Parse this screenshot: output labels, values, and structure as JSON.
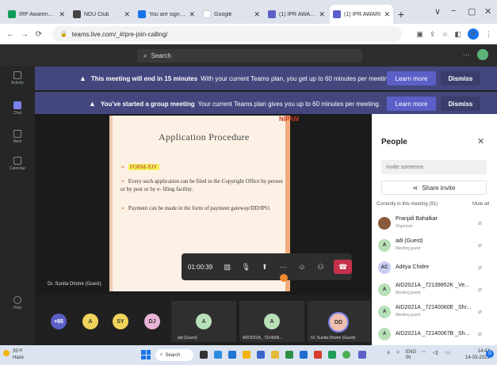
{
  "browser": {
    "tabs": [
      {
        "title": "IRP Awareness - G",
        "fav_color": "#0f9d58",
        "active": false
      },
      {
        "title": "NDU Club",
        "fav_color": "#444444",
        "active": false
      },
      {
        "title": "You are signed in",
        "fav_color": "#1a73e8",
        "active": false
      },
      {
        "title": "Google",
        "fav_color": "#ffffff",
        "active": false
      },
      {
        "title": "(1) IPR AWARENES",
        "fav_color": "#5b5fc7",
        "active": false
      },
      {
        "title": "(1) IPR AWARI",
        "fav_color": "#5b5fc7",
        "active": true
      }
    ],
    "new_tab": "+",
    "window_controls": [
      "∨",
      "−",
      "▢",
      "✕"
    ],
    "url": "teams.live.com/_#/pre-join-calling/",
    "profile_initial": "P"
  },
  "teams": {
    "search_placeholder": "Search",
    "more": "···"
  },
  "rail": [
    {
      "label": "Activity",
      "active": false
    },
    {
      "label": "Chat",
      "active": true
    },
    {
      "label": "Meet",
      "active": false
    },
    {
      "label": "Calendar",
      "active": false
    },
    {
      "label": "Help",
      "active": false
    }
  ],
  "banners": [
    {
      "bold": "This meeting will end in 15 minutes",
      "text": "With your current Teams plan, you get up to 60 minutes per meeting.",
      "learn": "Learn more",
      "dismiss": "Dismiss"
    },
    {
      "bold": "You've started a group meeting",
      "text": "Your current Teams plan gives you up to 60 minutes per meeting.",
      "learn": "Learn more",
      "dismiss": "Dismiss"
    }
  ],
  "slide": {
    "header": "NIPAM",
    "title": "Application Procedure",
    "form": "FORM-XIV",
    "bullet1": "Every such application can be filed in the Copyright Office by person or by post or by e- filing facility.",
    "bullet2": "Payment can be made in the form of payment gateway/DD/IPO."
  },
  "speaker": "Dr. Sunita Dhotre (Guest)",
  "controls": {
    "timer": "01:00:39",
    "icons": [
      "camera-off-icon",
      "mic-off-icon",
      "share-icon",
      "more-icon",
      "reactions-icon",
      "people-icon"
    ],
    "leave": "leave-call-icon"
  },
  "strip": {
    "overflow": "+85",
    "bubbles": [
      {
        "initials": "A",
        "color": "#f0d35c"
      },
      {
        "initials": "SY",
        "color": "#f0d35c"
      },
      {
        "initials": "DJ",
        "color": "#e8b4d8"
      }
    ],
    "tiles": [
      {
        "initial": "A",
        "label": "adi (Guest)",
        "color": "#b8e0b8"
      },
      {
        "initial": "A",
        "label": "AID2021A_ 7214006...",
        "color": "#b8e0b8"
      },
      {
        "initial": "DD",
        "label": "Dr. Sunita Dhotre (Guest)",
        "color": "#f0c0b0"
      }
    ]
  },
  "people": {
    "title": "People",
    "invite_placeholder": "Invite someone",
    "share_invite": "Share invite",
    "section": "Currently in this meeting (91)",
    "mute_all": "Mute all",
    "participants": [
      {
        "initials": "",
        "name": "Pranjali Bahalkar",
        "role": "Organizer",
        "color": "#8a5a3c"
      },
      {
        "initials": "A",
        "name": "adi (Guest)",
        "role": "Meeting guest",
        "color": "#b8e0b8"
      },
      {
        "initials": "AC",
        "name": "Aditya Chidre",
        "role": "",
        "color": "#c9cdf2"
      },
      {
        "initials": "A",
        "name": "AID2021A _72139852K _Ve...",
        "role": "Meeting guest",
        "color": "#b8e0b8"
      },
      {
        "initials": "A",
        "name": "AID2021A _72140060E _Shr...",
        "role": "Meeting guest",
        "color": "#b8e0b8"
      },
      {
        "initials": "A",
        "name": "AID2021A _72140067B _Sh...",
        "role": "",
        "color": "#b8e0b8"
      }
    ]
  },
  "taskbar": {
    "temp": "35°F",
    "weather": "Haze",
    "search": "Search",
    "lang": "ENG",
    "lang2": "IN",
    "time": "14:47",
    "date": "14-03-2023"
  }
}
